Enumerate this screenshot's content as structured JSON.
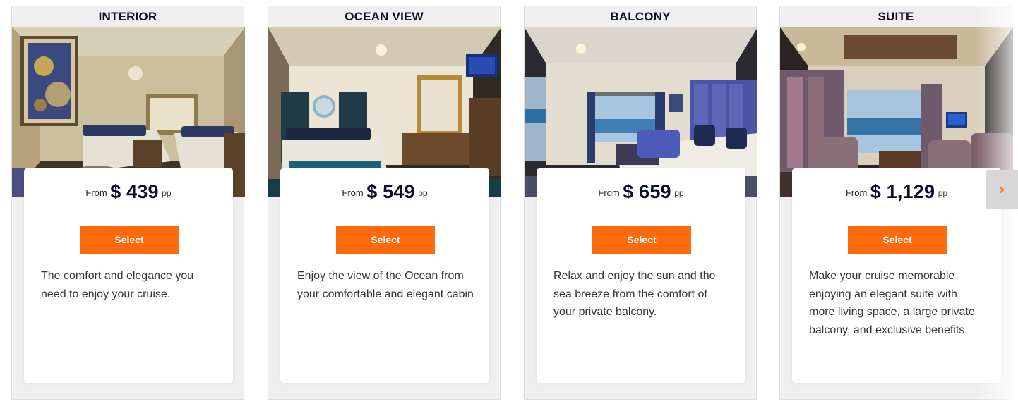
{
  "cabins": [
    {
      "title": "INTERIOR",
      "from_label": "From",
      "price": "$ 439",
      "per": "pp",
      "select_label": "Select",
      "description": "The comfort and elegance you need to enjoy your cruise.",
      "photo_icon": "interior-cabin-photo"
    },
    {
      "title": "OCEAN VIEW",
      "from_label": "From",
      "price": "$ 549",
      "per": "pp",
      "select_label": "Select",
      "description": "Enjoy the view of the Ocean from your comfortable and elegant cabin",
      "photo_icon": "ocean-view-cabin-photo"
    },
    {
      "title": "BALCONY",
      "from_label": "From",
      "price": "$ 659",
      "per": "pp",
      "select_label": "Select",
      "description": "Relax and enjoy the sun and the sea breeze from the comfort of your private balcony.",
      "photo_icon": "balcony-cabin-photo"
    },
    {
      "title": "SUITE",
      "from_label": "From",
      "price": "$ 1,129",
      "per": "pp",
      "select_label": "Select",
      "description": "Make your cruise memorable enjoying an elegant suite with more living space, a large private balcony, and exclusive benefits.",
      "photo_icon": "suite-cabin-photo"
    }
  ],
  "carousel": {
    "next_icon": "chevron-right-icon"
  },
  "colors": {
    "accent": "#ff6a0d",
    "title_text": "#0b0e2c",
    "card_bg": "#efefef",
    "panel_bg": "#ffffff"
  }
}
